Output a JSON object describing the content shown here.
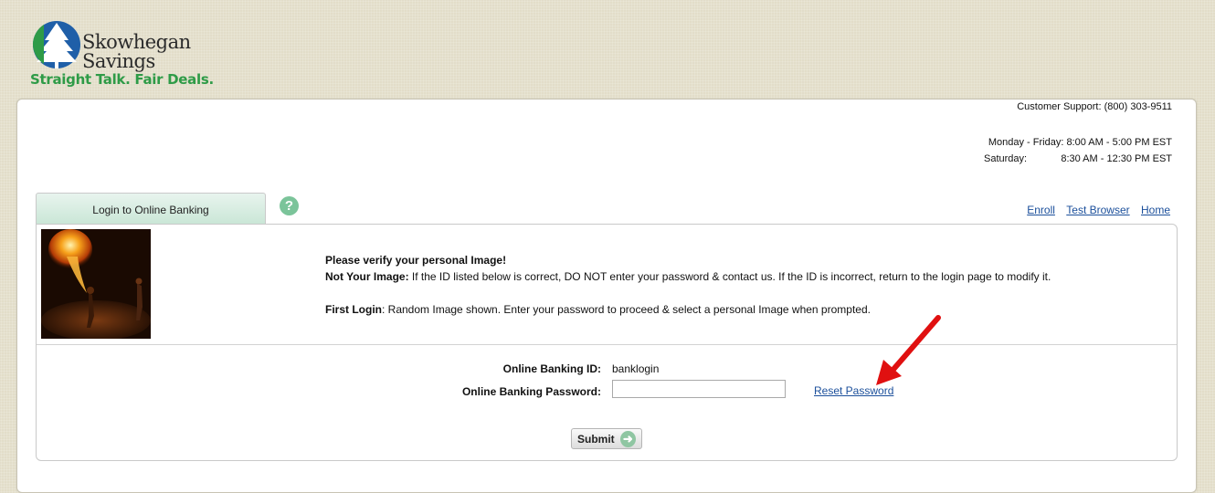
{
  "brand": {
    "name_line1": "Skowhegan",
    "name_line2": "Savings",
    "tagline": "Straight Talk. Fair Deals.",
    "logo_blue": "#1f5fa8",
    "logo_green": "#2e9b47"
  },
  "support": {
    "phone_text": "Customer Support: (800) 303-9511",
    "weekday_label": "Monday - Friday:",
    "weekday_hours": "8:00 AM - 5:00 PM EST",
    "saturday_label": "Saturday:",
    "saturday_hours": "8:30 AM - 12:30 PM EST"
  },
  "tab": {
    "label": "Login to Online Banking"
  },
  "help_icon": "help-icon",
  "toplinks": {
    "enroll": "Enroll",
    "test_browser": "Test Browser",
    "home": "Home"
  },
  "verify": {
    "heading": "Please verify your personal Image!",
    "not_your_image_label": "Not Your Image:",
    "not_your_image_text": " If the ID listed below is correct, DO NOT enter your password & contact us. If the ID is incorrect, return to the login page to modify it.",
    "first_login_label": "First Login",
    "first_login_text": ": Random Image shown. Enter your password to proceed & select a personal Image when prompted."
  },
  "form": {
    "id_label": "Online Banking ID:",
    "id_value": "banklogin",
    "password_label": "Online Banking Password:",
    "password_value": "",
    "reset_link": "Reset Password",
    "submit_label": "Submit"
  },
  "colors": {
    "link": "#1b4f9b",
    "tab_green": "#c9e6d6",
    "annotation_arrow": "#e01010"
  }
}
